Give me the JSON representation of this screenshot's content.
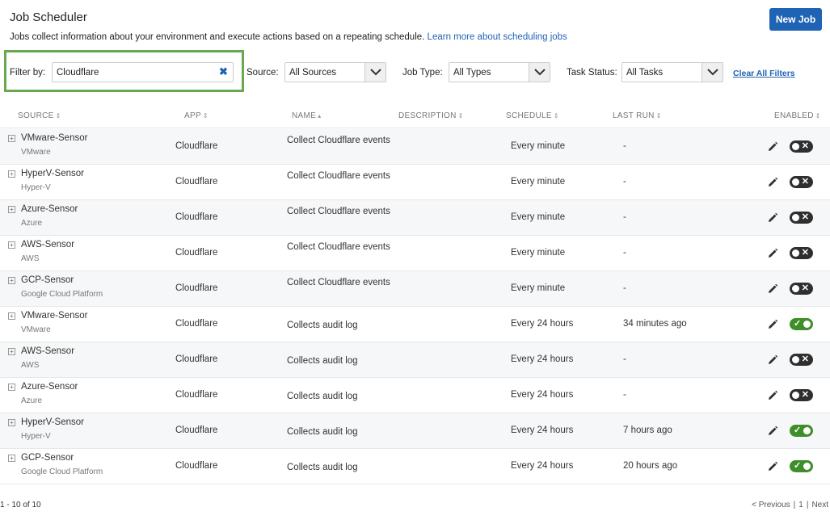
{
  "page": {
    "title": "Job Scheduler",
    "new_job_label": "New Job",
    "description": "Jobs collect information about your environment and execute actions based on a repeating schedule. ",
    "learn_more": "Learn more about scheduling jobs"
  },
  "filters": {
    "filter_label": "Filter by:",
    "filter_value": "Cloudflare",
    "clear_icon": "close-icon",
    "source_label": "Source:",
    "source_value": "All Sources",
    "job_type_label": "Job Type:",
    "job_type_value": "All Types",
    "task_status_label": "Task Status:",
    "task_status_value": "All Tasks",
    "clear_all": "Clear All Filters",
    "highlight_color": "#6aa84f"
  },
  "table": {
    "headers": {
      "source": "SOURCE",
      "app": "APP",
      "name": "NAME",
      "description": "DESCRIPTION",
      "schedule": "SCHEDULE",
      "last_run": "LAST RUN",
      "enabled": "ENABLED"
    },
    "rows": [
      {
        "source": "VMware-Sensor",
        "source_type": "VMware",
        "app": "Cloudflare",
        "name": "Collect Cloudflare events",
        "schedule": "Every minute",
        "last_run": "-",
        "enabled": false
      },
      {
        "source": "HyperV-Sensor",
        "source_type": "Hyper-V",
        "app": "Cloudflare",
        "name": "Collect Cloudflare events",
        "schedule": "Every minute",
        "last_run": "-",
        "enabled": false
      },
      {
        "source": "Azure-Sensor",
        "source_type": "Azure",
        "app": "Cloudflare",
        "name": "Collect Cloudflare events",
        "schedule": "Every minute",
        "last_run": "-",
        "enabled": false
      },
      {
        "source": "AWS-Sensor",
        "source_type": "AWS",
        "app": "Cloudflare",
        "name": "Collect Cloudflare events",
        "schedule": "Every minute",
        "last_run": "-",
        "enabled": false
      },
      {
        "source": "GCP-Sensor",
        "source_type": "Google Cloud Platform",
        "app": "Cloudflare",
        "name": "Collect Cloudflare events",
        "schedule": "Every minute",
        "last_run": "-",
        "enabled": false
      },
      {
        "source": "VMware-Sensor",
        "source_type": "VMware",
        "app": "Cloudflare",
        "name": "Collects audit log",
        "schedule": "Every 24 hours",
        "last_run": "34 minutes ago",
        "enabled": true
      },
      {
        "source": "AWS-Sensor",
        "source_type": "AWS",
        "app": "Cloudflare",
        "name": "Collects audit log",
        "schedule": "Every 24 hours",
        "last_run": "-",
        "enabled": false
      },
      {
        "source": "Azure-Sensor",
        "source_type": "Azure",
        "app": "Cloudflare",
        "name": "Collects audit log",
        "schedule": "Every 24 hours",
        "last_run": "-",
        "enabled": false
      },
      {
        "source": "HyperV-Sensor",
        "source_type": "Hyper-V",
        "app": "Cloudflare",
        "name": "Collects audit log",
        "schedule": "Every 24 hours",
        "last_run": "7 hours ago",
        "enabled": true
      },
      {
        "source": "GCP-Sensor",
        "source_type": "Google Cloud Platform",
        "app": "Cloudflare",
        "name": "Collects audit log",
        "schedule": "Every 24 hours",
        "last_run": "20 hours ago",
        "enabled": true
      }
    ]
  },
  "footer": {
    "count": "1 - 10 of 10",
    "previous": "< Previous",
    "separator": "|",
    "page": "1",
    "next": "Next"
  },
  "colors": {
    "accent": "#1f63b4",
    "toggle_on": "#3e8e2a",
    "toggle_off": "#2f2f2f"
  }
}
